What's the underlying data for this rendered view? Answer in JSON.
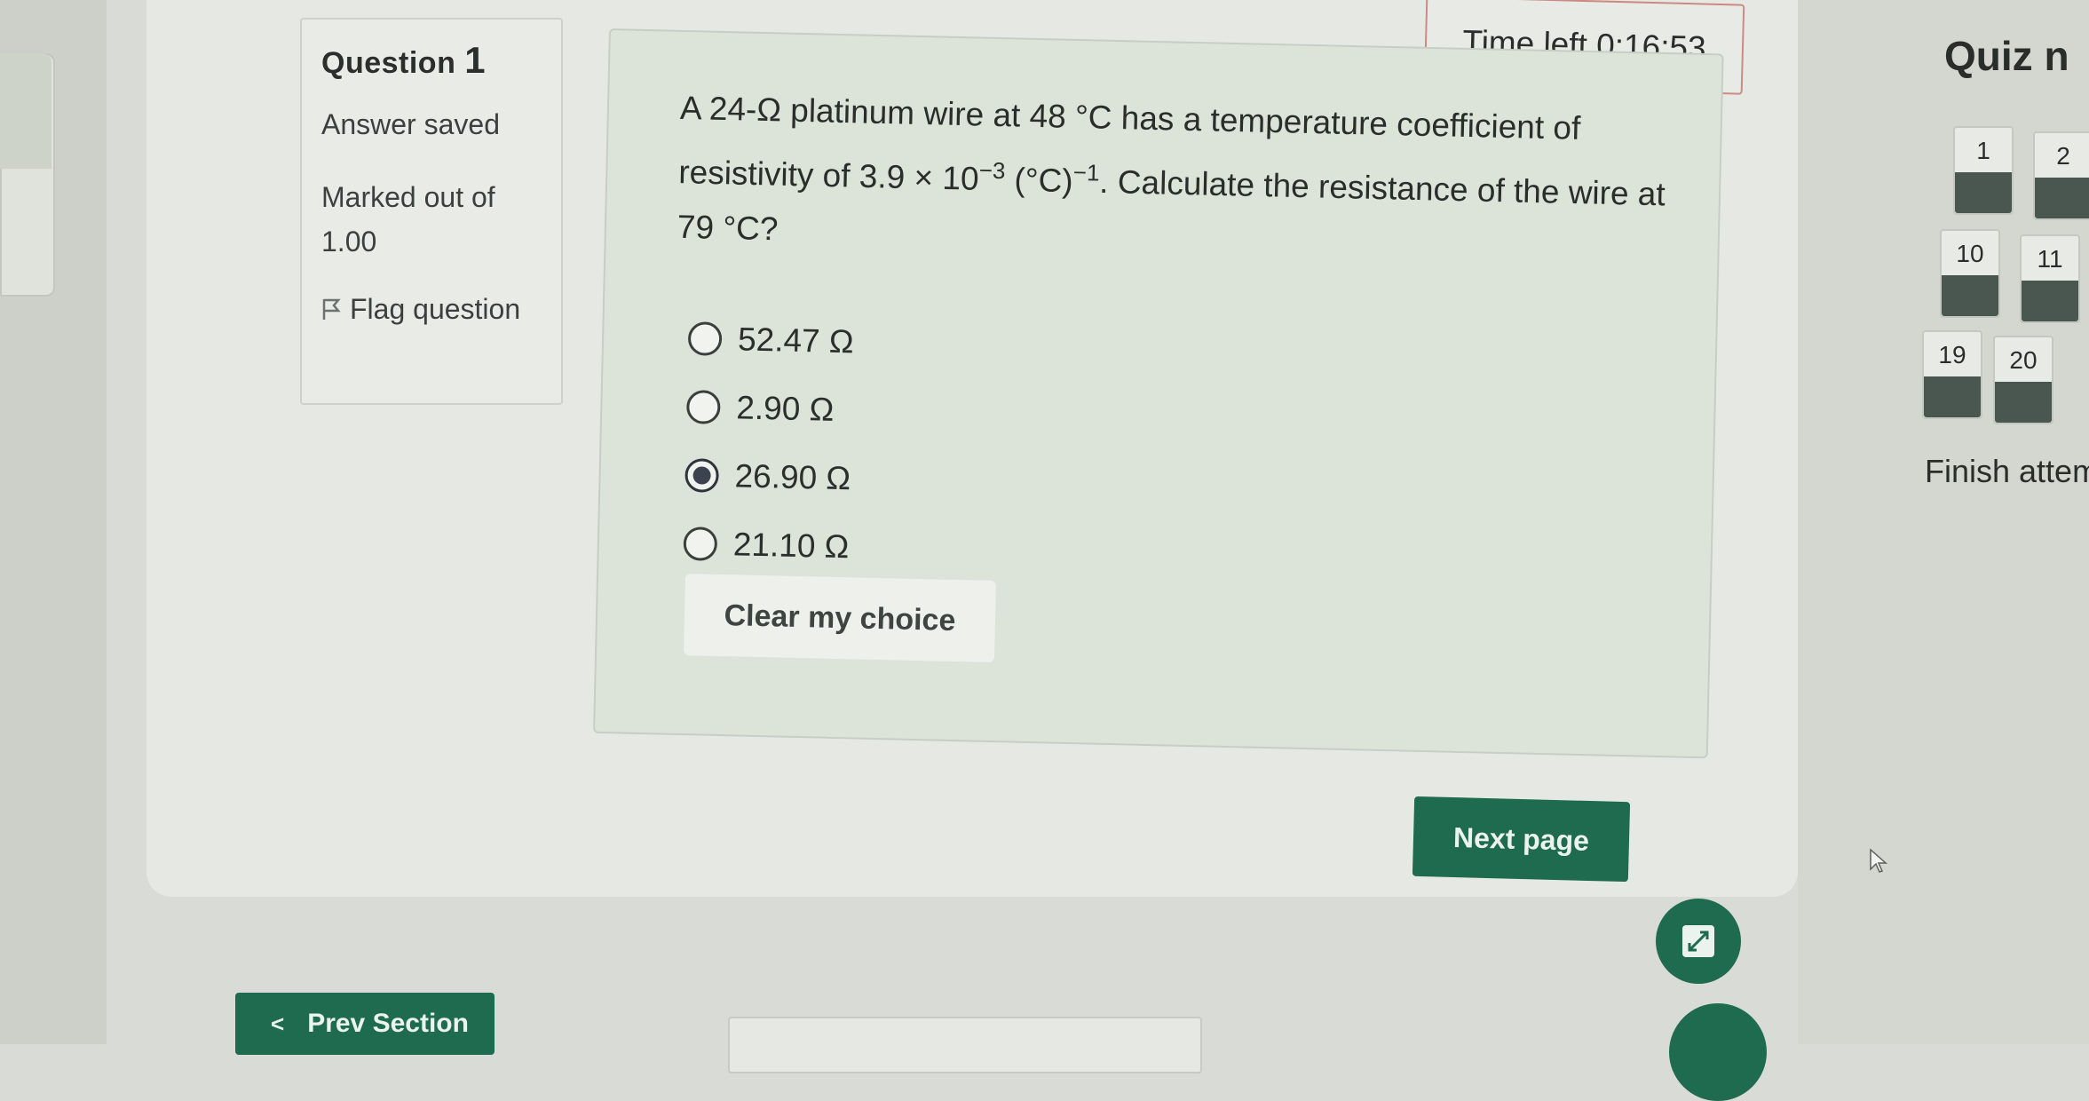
{
  "question_info": {
    "label": "Question",
    "number": "1",
    "state": "Answer saved",
    "marked_out_of": "Marked out of 1.00",
    "flag_label": "Flag question"
  },
  "timer": {
    "text": "Time left 0:16:53"
  },
  "question": {
    "text_part1": "A 24-Ω platinum wire at 48 °C has a temperature coefficient of resistivity of 3.9 × 10",
    "exponent1": "−3",
    "text_part2": " (°C)",
    "exponent2": "−1",
    "text_part3": ". Calculate the resistance of the wire at 79 °C?",
    "options": [
      {
        "label": "52.47 Ω",
        "selected": false
      },
      {
        "label": "2.90 Ω",
        "selected": false
      },
      {
        "label": "26.90 Ω",
        "selected": true
      },
      {
        "label": "21.10 Ω",
        "selected": false
      }
    ],
    "clear_label": "Clear my choice"
  },
  "buttons": {
    "next_page": "Next page",
    "prev_section": "Prev Section"
  },
  "quiz_nav": {
    "title": "Quiz n",
    "items": [
      "1",
      "2",
      "10",
      "11",
      "19",
      "20"
    ],
    "finish": "Finish attem"
  },
  "colors": {
    "primary": "#1f6b4f",
    "timer_border": "#cc8a84",
    "answered": "#4a5750"
  }
}
